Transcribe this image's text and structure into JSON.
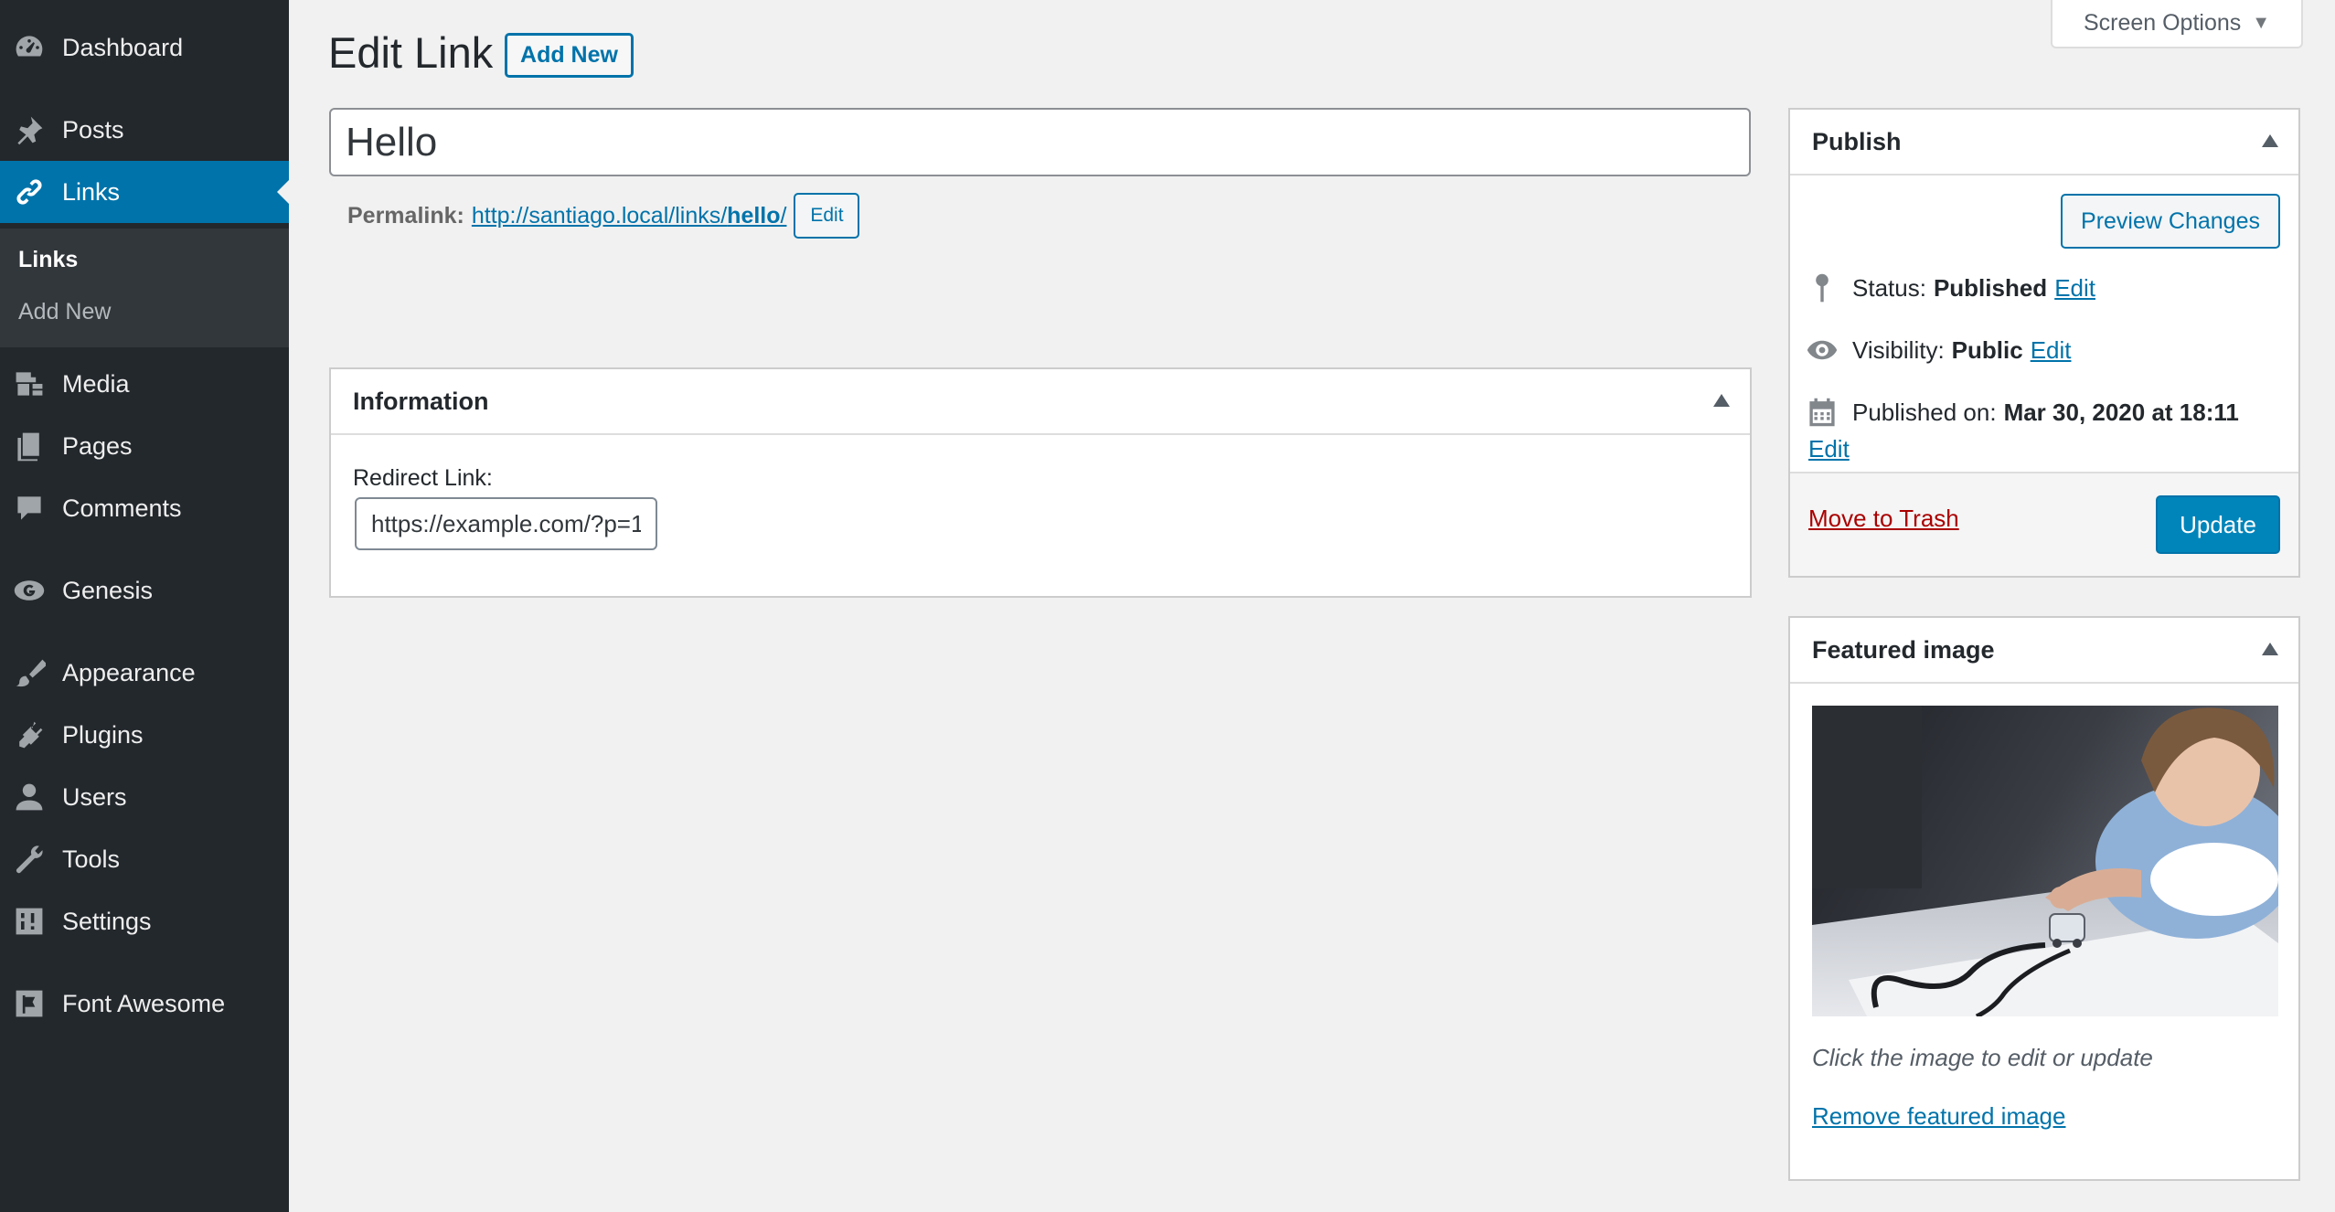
{
  "sidebar": {
    "items": [
      {
        "label": "Dashboard",
        "icon": "dashboard-icon"
      },
      {
        "label": "Posts",
        "icon": "pushpin-icon"
      },
      {
        "label": "Links",
        "icon": "link-icon",
        "current": true
      },
      {
        "label": "Media",
        "icon": "media-icon"
      },
      {
        "label": "Pages",
        "icon": "pages-icon"
      },
      {
        "label": "Comments",
        "icon": "comments-icon"
      },
      {
        "label": "Genesis",
        "icon": "genesis-icon"
      },
      {
        "label": "Appearance",
        "icon": "brush-icon"
      },
      {
        "label": "Plugins",
        "icon": "plugin-icon"
      },
      {
        "label": "Users",
        "icon": "user-icon"
      },
      {
        "label": "Tools",
        "icon": "wrench-icon"
      },
      {
        "label": "Settings",
        "icon": "settings-icon"
      },
      {
        "label": "Font Awesome",
        "icon": "flag-icon"
      }
    ],
    "submenu": [
      {
        "label": "Links",
        "current": true
      },
      {
        "label": "Add New"
      }
    ]
  },
  "screen_options": {
    "label": "Screen Options",
    "arrow": "▼"
  },
  "header": {
    "title": "Edit Link",
    "add_new": "Add New"
  },
  "post": {
    "title": "Hello",
    "permalink_label": "Permalink:",
    "permalink_base": "http://santiago.local/links/",
    "permalink_slug": "hello",
    "permalink_trailing": "/",
    "permalink_edit": "Edit"
  },
  "information": {
    "title": "Information",
    "redirect_label": "Redirect Link:",
    "redirect_value": "https://example.com/?p=1"
  },
  "publish": {
    "title": "Publish",
    "preview": "Preview Changes",
    "status_label": "Status:",
    "status_value": "Published",
    "visibility_label": "Visibility:",
    "visibility_value": "Public",
    "published_label": "Published on:",
    "published_value": "Mar 30, 2020 at 18:11",
    "edit": "Edit",
    "trash": "Move to Trash",
    "update": "Update"
  },
  "featured": {
    "title": "Featured image",
    "caption": "Click the image to edit or update",
    "remove": "Remove featured image"
  },
  "colors": {
    "sidebar_bg": "#23282d",
    "accent": "#0073aa",
    "primary_button": "#0085ba",
    "trash": "#aa0000"
  }
}
